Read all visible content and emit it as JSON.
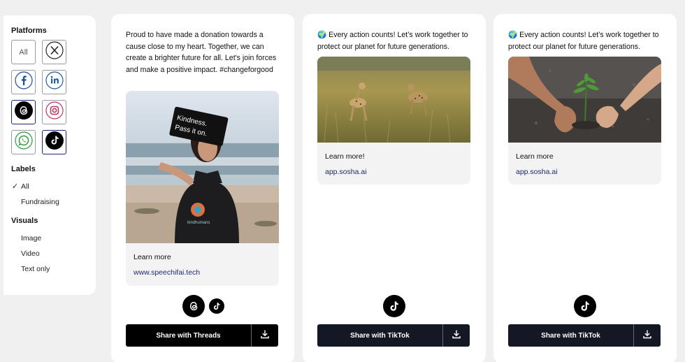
{
  "sidebar": {
    "platforms_title": "Platforms",
    "all_label": "All",
    "platforms": [
      {
        "name": "all",
        "label": "All",
        "selected": false
      },
      {
        "name": "x",
        "icon": "x-logo-icon",
        "selected": false
      },
      {
        "name": "facebook",
        "icon": "facebook-icon",
        "selected": false
      },
      {
        "name": "linkedin",
        "icon": "linkedin-icon",
        "selected": false
      },
      {
        "name": "threads",
        "icon": "threads-icon",
        "selected": true
      },
      {
        "name": "instagram",
        "icon": "instagram-icon",
        "selected": false
      },
      {
        "name": "whatsapp",
        "icon": "whatsapp-icon",
        "selected": false
      },
      {
        "name": "tiktok",
        "icon": "tiktok-icon",
        "selected": true
      }
    ],
    "labels_title": "Labels",
    "labels": [
      "All",
      "Fundraising"
    ],
    "labels_selected": "All",
    "visuals_title": "Visuals",
    "visuals": [
      "Image",
      "Video",
      "Text only"
    ]
  },
  "cards": [
    {
      "caption": "Proud to have made a donation towards a cause close to my heart. Together, we can create a brighter future for all. Let's join forces and make a positive impact. #changeforgood",
      "sign_text": "Kindness. Pass it on.",
      "shirt_text": "kindhumans",
      "learn": "Learn more",
      "link": "www.speechifai.tech",
      "platform_icons": [
        "threads-icon",
        "tiktok-icon"
      ],
      "share_label": "Share with Threads",
      "colors": {
        "share_bg": "#000000"
      }
    },
    {
      "caption": "🌍 Every action counts! Let’s work together to protect our planet for future generations.",
      "learn": "Learn more!",
      "link": "app.sosha.ai",
      "platform_icons": [
        "tiktok-icon"
      ],
      "share_label": "Share with TikTok",
      "colors": {
        "share_bg": "#141824"
      }
    },
    {
      "caption": "🌍 Every action counts! Let’s work together to protect our planet for future generations.",
      "learn": "Learn more",
      "link": "app.sosha.ai",
      "platform_icons": [
        "tiktok-icon"
      ],
      "share_label": "Share with TikTok",
      "colors": {
        "share_bg": "#141824"
      }
    }
  ],
  "colors": {
    "accent": "#1d2a6b",
    "link": "#1d2a6b",
    "background": "#f0f0f1"
  }
}
